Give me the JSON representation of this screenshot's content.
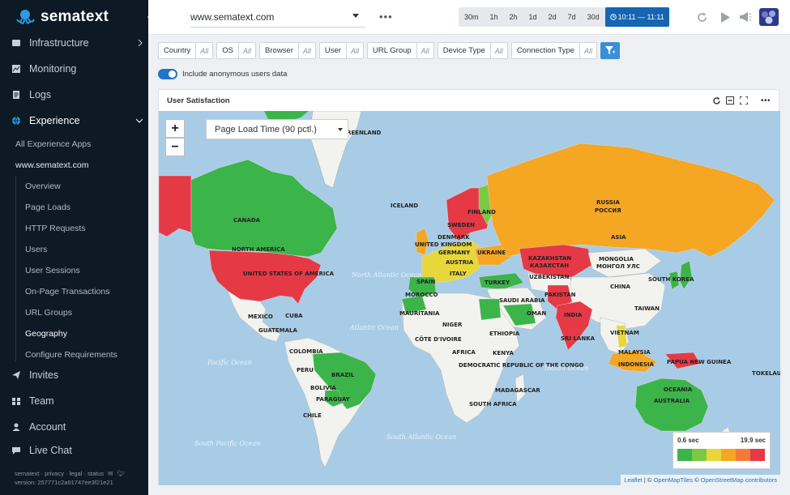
{
  "brand": {
    "name": "sematext"
  },
  "sidebar": {
    "infrastructure": "Infrastructure",
    "monitoring": "Monitoring",
    "logs": "Logs",
    "experience": "Experience",
    "all_apps": "All Experience Apps",
    "app_name": "www.sematext.com",
    "subitems": [
      "Overview",
      "Page Loads",
      "HTTP Requests",
      "Users",
      "User Sessions",
      "On-Page Transactions",
      "URL Groups",
      "Geography",
      "Configure Requirements"
    ],
    "invites": "Invites",
    "team": "Team",
    "account": "Account",
    "live_chat": "Live Chat",
    "footer_links": "sematext · privacy · legal · status",
    "version": "version: 257771c2a91747ee3f21e21"
  },
  "topbar": {
    "app": "www.sematext.com",
    "more": "•••",
    "ranges": [
      "30m",
      "1h",
      "2h",
      "1d",
      "2d",
      "7d",
      "30d"
    ],
    "active_range": "10:11 — 11:11"
  },
  "filters": [
    {
      "label": "Country",
      "value": "All"
    },
    {
      "label": "OS",
      "value": "All"
    },
    {
      "label": "Browser",
      "value": "All"
    },
    {
      "label": "User",
      "value": "All"
    },
    {
      "label": "URL Group",
      "value": "All"
    },
    {
      "label": "Device Type",
      "value": "All"
    },
    {
      "label": "Connection Type",
      "value": "All"
    }
  ],
  "toggle_label": "Include anonymous users data",
  "panel": {
    "title": "User Satisfaction",
    "metric": "Page Load Time (90 pctl.)",
    "zoom_in": "+",
    "zoom_out": "−",
    "legend_min": "0.6 sec",
    "legend_max": "19.9 sec",
    "legend_colors": [
      "#3bb449",
      "#7ac943",
      "#e8d73a",
      "#f5a623",
      "#f47a3a",
      "#e53946"
    ],
    "attribution": {
      "leaflet": "Leaflet",
      "sep": " | © ",
      "omt": "OpenMapTiles",
      "sep2": " © ",
      "osm": "OpenStreetMap contributors"
    }
  },
  "map_labels": {
    "greenland": "REENLAND",
    "iceland": "ICELAND",
    "canada": "CANADA",
    "north_america": "NORTH AMERICA",
    "usa": "UNITED STATES OF AMERICA",
    "mexico": "MEXICO",
    "cuba": "CUBA",
    "guatemala": "GUATEMALA",
    "colombia": "COLOMBIA",
    "peru": "PERU",
    "brazil": "BRAZIL",
    "bolivia": "BOLIVIA",
    "paraguay": "PARAGUAY",
    "chile": "CHILE",
    "finland": "FINLAND",
    "sweden": "SWEDEN",
    "denmark": "DENMARK",
    "united_kingdom": "UNITED KINGDOM",
    "germany": "GERMANY",
    "austria": "AUSTRIA",
    "ukraine": "UKRAINE",
    "spain": "SPAIN",
    "italy": "ITALY",
    "morocco": "MOROCCO",
    "turkey": "TURKEY",
    "russia": "RUSSIA",
    "russia_local": "РОССИЯ",
    "asia": "ASIA",
    "kazakhstan": "KAZAKHSTAN",
    "kazakhstan_local": "КАЗАХСТАН",
    "uzbekistan": "UZBEKISTAN",
    "mongolia": "MONGOLIA",
    "mongolia_local": "МОНГОЛ УЛС",
    "china": "CHINA",
    "south_korea": "SOUTH KOREA",
    "taiwan": "TAIWAN",
    "pakistan": "PAKISTAN",
    "india": "INDIA",
    "sri_lanka": "SRI LANKA",
    "saudi_arabia": "SAUDI ARABIA",
    "oman": "OMAN",
    "mauritania": "MAURITANIA",
    "niger": "NIGER",
    "africa": "AFRICA",
    "cote": "CÔTE D'IVOIRE",
    "ethiopia": "ETHIOPIA",
    "kenya": "KENYA",
    "drc": "DEMOCRATIC REPUBLIC OF THE CONGO",
    "madagascar": "MADAGASCAR",
    "south_africa": "SOUTH AFRICA",
    "vietnam": "VIETNAM",
    "malaysia": "MALAYSIA",
    "indonesia": "INDONESIA",
    "png": "PAPUA NEW GUINEA",
    "oceania": "OCEANIA",
    "australia": "AUSTRALIA",
    "tokelau": "TOKELAU",
    "north_atlantic": "North Atlantic Ocean",
    "atlantic": "Atlantic Ocean",
    "south_atlantic": "South Atlantic Ocean",
    "indian": "Indian Ocean",
    "south_pacific": "South Pacific Ocean",
    "pacific": "Pacific Ocean"
  }
}
